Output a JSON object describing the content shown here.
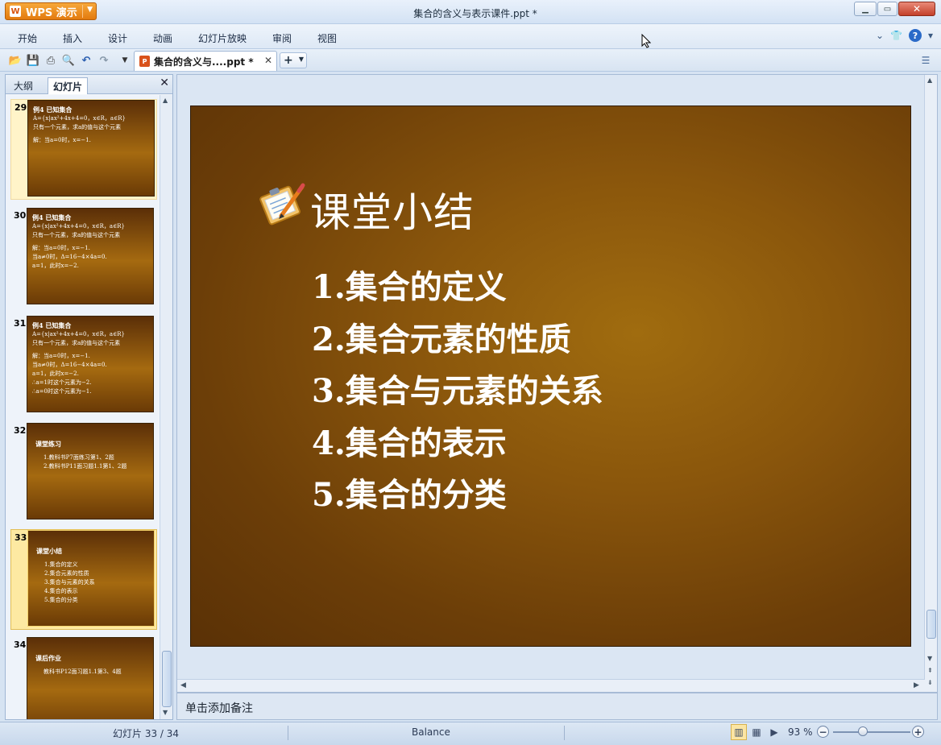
{
  "app": {
    "name": "WPS 演示",
    "window_title": "集合的含义与表示课件.ppt *"
  },
  "menu": {
    "items": [
      "开始",
      "插入",
      "设计",
      "动画",
      "幻灯片放映",
      "审阅",
      "视图"
    ]
  },
  "toolbar": {
    "doc_tab_label": "集合的含义与....ppt *",
    "icons": [
      "open-icon",
      "save-icon",
      "print-icon",
      "print-preview-icon",
      "undo-icon",
      "redo-icon",
      "customize-dropdown-icon"
    ]
  },
  "left_panel": {
    "tabs": [
      "大纲",
      "幻灯片"
    ],
    "active_tab": "幻灯片",
    "thumbnails": [
      {
        "number": "29",
        "lines": [
          "例4 已知集合",
          "A={x|ax²+4x+4=0，x∈R，a∈R}",
          "只有一个元素，求a的值与这个元素",
          "解：当a=0时，x=−1."
        ]
      },
      {
        "number": "30",
        "lines": [
          "例4 已知集合",
          "A={x|ax²+4x+4=0，x∈R，a∈R}",
          "只有一个元素，求a的值与这个元素",
          "解：当a=0时，x=−1.",
          "当a≠0时，Δ=16−4×4a=0.",
          "a=1，此时x=−2."
        ]
      },
      {
        "number": "31",
        "lines": [
          "例4 已知集合",
          "A={x|ax²+4x+4=0，x∈R，a∈R}",
          "只有一个元素，求a的值与这个元素",
          "解：当a=0时，x=−1.",
          "当a≠0时，Δ=16−4×4a=0.",
          "a=1，此时x=−2.",
          "∴a=1时这个元素为−2.",
          "∴a=0时这个元素为−1."
        ]
      },
      {
        "number": "32",
        "title": "课堂练习",
        "lines": [
          "1.教科书P7面练习第1、2题",
          "2.教科书P11面习题1.1第1、2题"
        ]
      },
      {
        "number": "33",
        "title": "课堂小结",
        "lines": [
          "1.集合的定义",
          "2.集合元素的性质",
          "3.集合与元素的关系",
          "4.集合的表示",
          "5.集合的分类"
        ]
      },
      {
        "number": "34",
        "title": "课后作业",
        "lines": [
          "教科书P12面习题1.1第3、4题"
        ]
      }
    ]
  },
  "slide": {
    "title": "课堂小结",
    "items": [
      "1.集合的定义",
      "2.集合元素的性质",
      "3.集合与元素的关系",
      "4.集合的表示",
      "5.集合的分类"
    ]
  },
  "notes": {
    "placeholder": "单击添加备注"
  },
  "status": {
    "slide_counter": "幻灯片 33 / 34",
    "theme": "Balance",
    "zoom": "93 %",
    "zoom_fraction": 0.39
  },
  "colors": {
    "slide_dark": "#5a3106",
    "slide_light": "#a06c0f",
    "app_orange": "#e37a0e",
    "selected_thumb": "#fde9a2"
  }
}
